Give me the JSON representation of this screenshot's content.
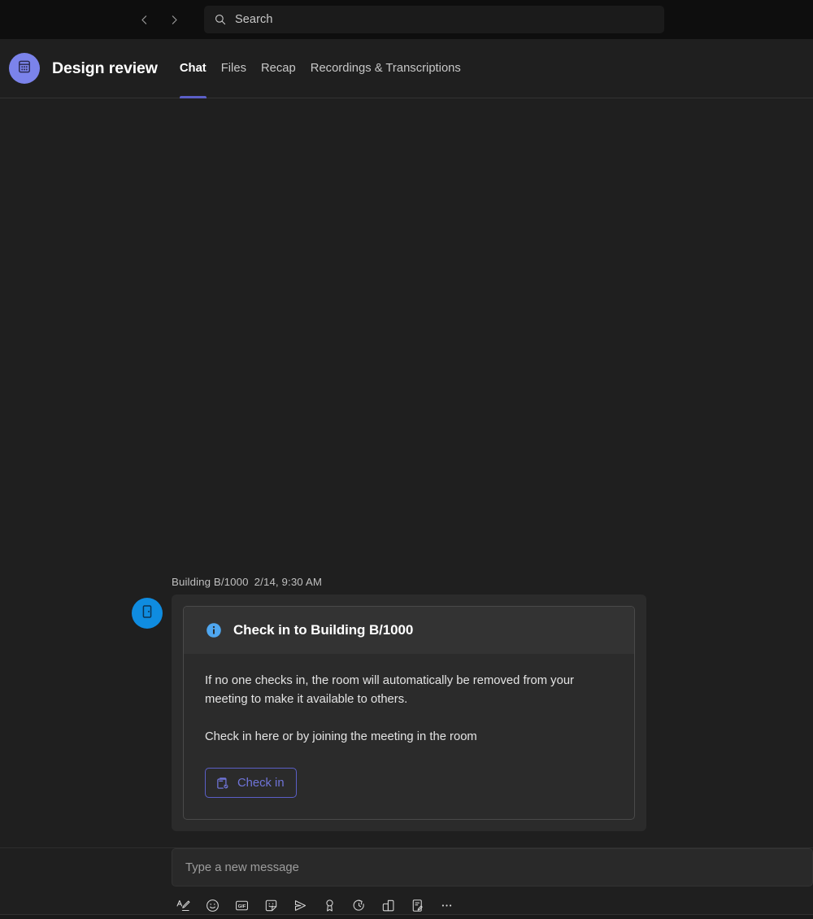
{
  "titlebar": {
    "back_icon": "chevron-left-icon",
    "forward_icon": "chevron-right-icon",
    "search": {
      "icon": "search-icon",
      "placeholder": "Search",
      "value": ""
    }
  },
  "header": {
    "avatar_icon": "calendar-meeting-icon",
    "title": "Design review",
    "tabs": [
      {
        "label": "Chat",
        "active": true
      },
      {
        "label": "Files",
        "active": false
      },
      {
        "label": "Recap",
        "active": false
      },
      {
        "label": "Recordings & Transcriptions",
        "active": false
      }
    ]
  },
  "message": {
    "sender": "Building B/1000",
    "timestamp": "2/14, 9:30 AM",
    "avatar_icon": "door-room-icon",
    "card": {
      "header_icon": "info-circle-icon",
      "header_title": "Check in to Building B/1000",
      "paragraphs": [
        "If no one checks in, the room will automatically be removed from your meeting to make it available to others.",
        "Check in here or by joining the meeting in the room"
      ],
      "action": {
        "label": "Check in",
        "icon": "device-checkin-icon"
      }
    }
  },
  "composer": {
    "placeholder": "Type a new message",
    "value": "",
    "tools": [
      {
        "name": "format-icon",
        "title": "Format"
      },
      {
        "name": "emoji-icon",
        "title": "Emoji"
      },
      {
        "name": "gif-icon",
        "title": "Giphy"
      },
      {
        "name": "sticker-icon",
        "title": "Sticker"
      },
      {
        "name": "send-plane-icon",
        "title": "Send"
      },
      {
        "name": "praise-ribbon-icon",
        "title": "Praise"
      },
      {
        "name": "loop-schedule-icon",
        "title": "Schedule"
      },
      {
        "name": "apps-icon",
        "title": "Apps"
      },
      {
        "name": "form-edit-icon",
        "title": "Forms"
      },
      {
        "name": "more-options-icon",
        "title": "More options"
      }
    ]
  },
  "colors": {
    "accent_purple": "#5b5fc7",
    "accent_blue": "#0f8ce0",
    "info_blue": "#4fa7f0",
    "avatar_purple": "#7b83eb",
    "background": "#1f1f1f",
    "titlebar": "#0e0e0e",
    "card_header": "#333333"
  }
}
